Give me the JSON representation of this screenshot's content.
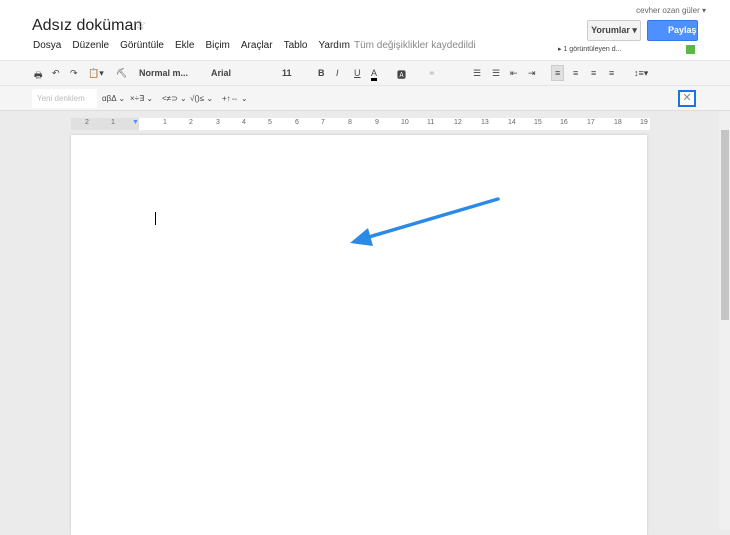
{
  "header": {
    "title": "Adsız doküman",
    "user": "cevher ozan güler ▾",
    "menu": [
      "Dosya",
      "Düzenle",
      "Görüntüle",
      "Ekle",
      "Biçim",
      "Araçlar",
      "Tablo",
      "Yardım"
    ],
    "saved_status": "Tüm değişiklikler kaydedildi",
    "comments_label": "Yorumlar ▾",
    "share_label": "Paylaş",
    "viewers": "▸ 1 görüntüleyen d..."
  },
  "toolbar": {
    "style": "Normal m...",
    "font": "Arial",
    "size": "11"
  },
  "equation": {
    "placeholder": "Yeni denklem",
    "groups": [
      "αβΔ ⌄",
      "×÷∃ ⌄",
      "<≠⊃ ⌄",
      "√()≤ ⌄",
      "+↑⇔ ⌄"
    ]
  },
  "ruler": {
    "ticks": [
      "2",
      "1",
      "1",
      "2",
      "3",
      "4",
      "5",
      "6",
      "7",
      "8",
      "9",
      "10",
      "11",
      "12",
      "13",
      "14",
      "15",
      "16",
      "17",
      "18",
      "19"
    ]
  },
  "colors": {
    "accent": "#4d90fe",
    "arrow": "#2b8ae6"
  }
}
